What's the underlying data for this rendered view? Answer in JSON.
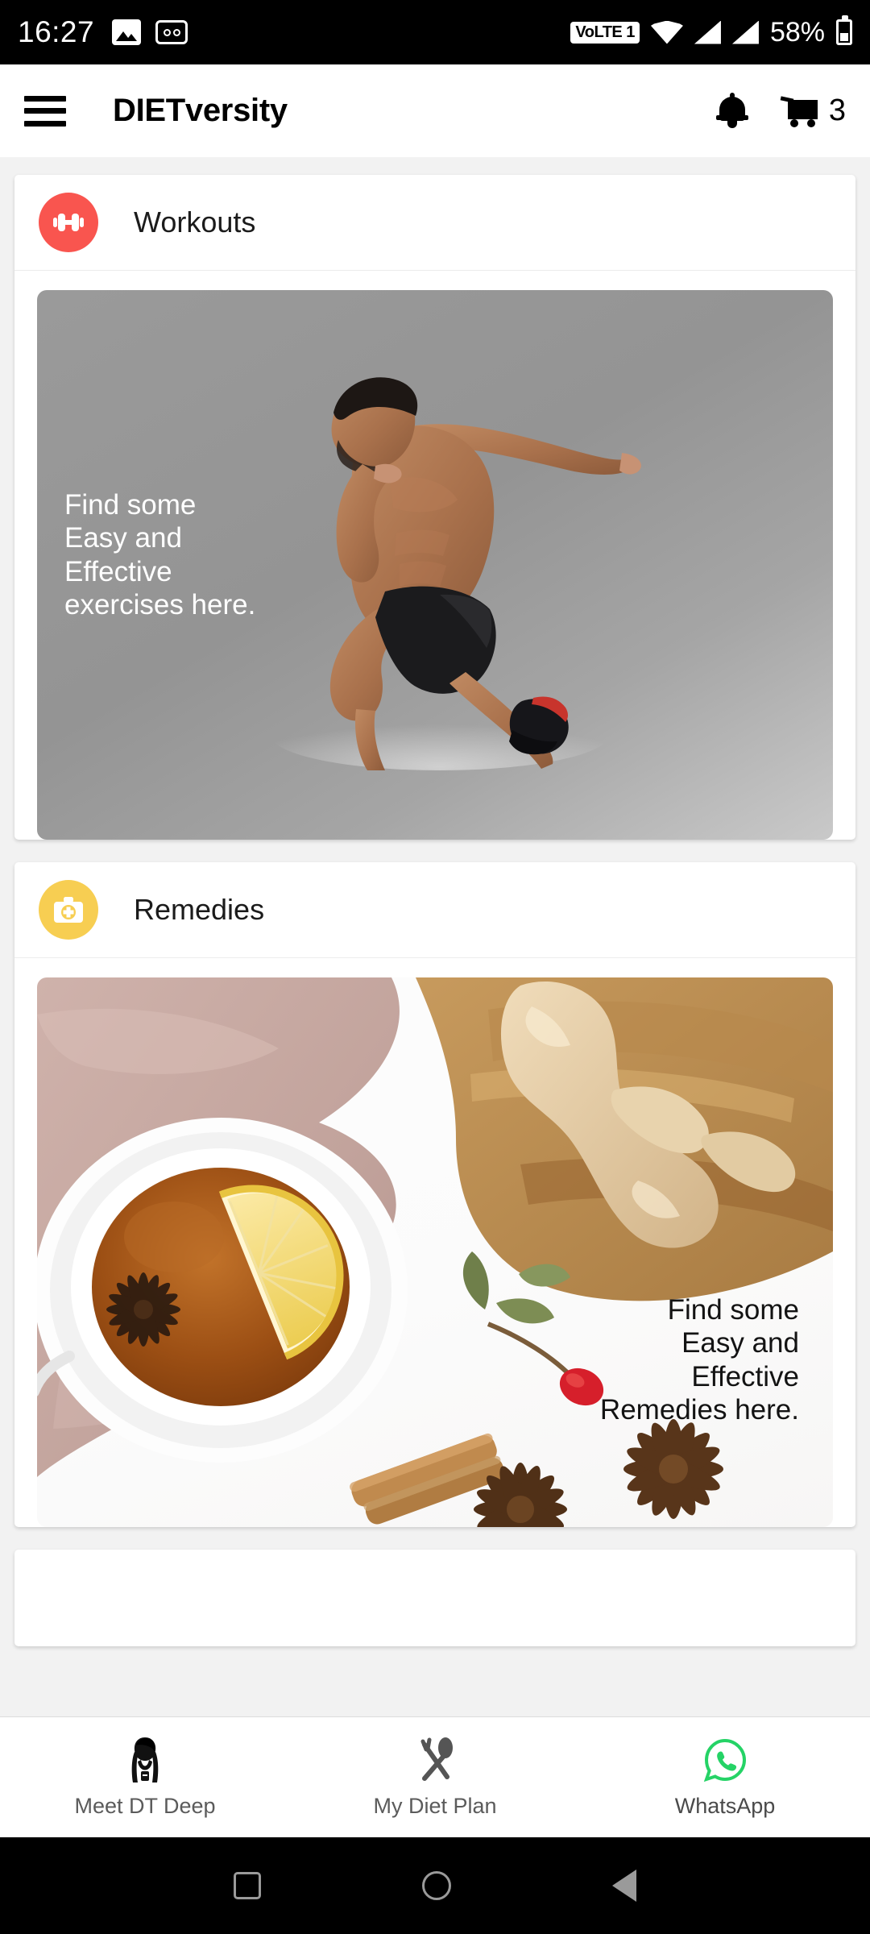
{
  "status_bar": {
    "time": "16:27",
    "icons_left": [
      "photo-icon",
      "voicemail-icon"
    ],
    "volte_label": "VoLTE 1",
    "icons_right": [
      "wifi-icon",
      "signal-icon",
      "signal-icon"
    ],
    "battery_percent": "58%"
  },
  "app_bar": {
    "menu_icon": "hamburger-icon",
    "title": "DIETversity",
    "notification_icon": "bell-icon",
    "cart_icon": "cart-icon",
    "cart_count": "3"
  },
  "cards": [
    {
      "id": "workouts",
      "title": "Workouts",
      "icon": "dumbbell-icon",
      "accent": "#F9554F",
      "banner_text": "Find some\nEasy and\nEffective\nexercises here.",
      "banner_text_color": "#ffffff",
      "banner_align": "left",
      "banner_image": "running-man-photo"
    },
    {
      "id": "remedies",
      "title": "Remedies",
      "icon": "medical-kit-icon",
      "accent": "#F7CE52",
      "banner_text": "Find some\nEasy and\nEffective\nRemedies here.",
      "banner_text_color": "#131313",
      "banner_align": "right",
      "banner_image": "herbal-tea-photo"
    }
  ],
  "bottom_nav": [
    {
      "label": "Meet DT Deep",
      "icon": "dietitian-icon"
    },
    {
      "label": "My Diet Plan",
      "icon": "spoon-fork-icon"
    },
    {
      "label": "WhatsApp",
      "icon": "whatsapp-icon"
    }
  ],
  "system_nav": {
    "recents": "square-icon",
    "home": "circle-icon",
    "back": "triangle-back-icon"
  },
  "colors": {
    "page_bg": "#f2f2f2",
    "card_bg": "#ffffff",
    "whatsapp_green": "#25D366"
  }
}
